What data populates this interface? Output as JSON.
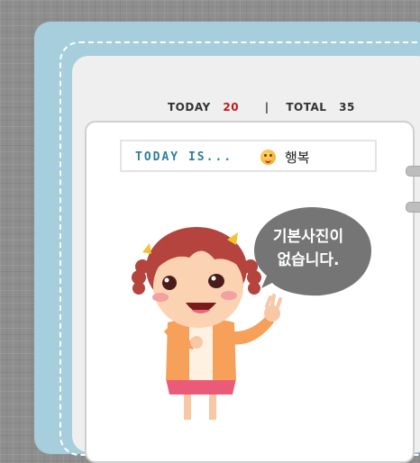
{
  "counter": {
    "today_label": "TODAY",
    "today_value": "20",
    "separator": "|",
    "total_label": "TOTAL",
    "total_value": "35"
  },
  "today_box": {
    "label": "TODAY IS...",
    "mood_icon": "smiley-face-icon",
    "mood_text": "행복"
  },
  "profile": {
    "placeholder_text_line1": "기본사진이",
    "placeholder_text_line2": "없습니다."
  },
  "colors": {
    "background": "#8e8e8e",
    "frame": "#a6cedc",
    "counter_today": "#c0191f",
    "today_label": "#2e7f9e",
    "bubble": "#757575"
  }
}
